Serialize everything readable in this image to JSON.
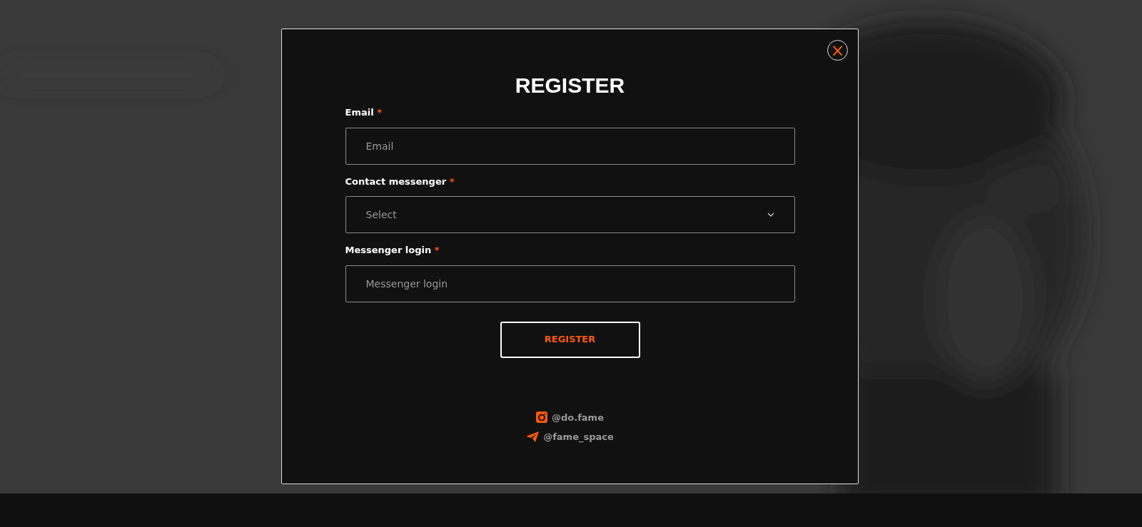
{
  "dialog": {
    "title": "REGISTER",
    "close_icon": "×"
  },
  "fields": [
    {
      "kind": "input",
      "label": "Email",
      "required_mark": "*",
      "placeholder": "Email"
    },
    {
      "kind": "select",
      "label": "Contact messenger",
      "required_mark": "*",
      "placeholder": "Select"
    },
    {
      "kind": "input",
      "label": "Messenger login",
      "required_mark": "*",
      "placeholder": "Messenger login"
    }
  ],
  "submit": {
    "label": "REGISTER"
  },
  "socials": [
    {
      "kind": "instagram",
      "handle": "@do.fame"
    },
    {
      "kind": "telegram",
      "handle": "@fame_space"
    }
  ]
}
